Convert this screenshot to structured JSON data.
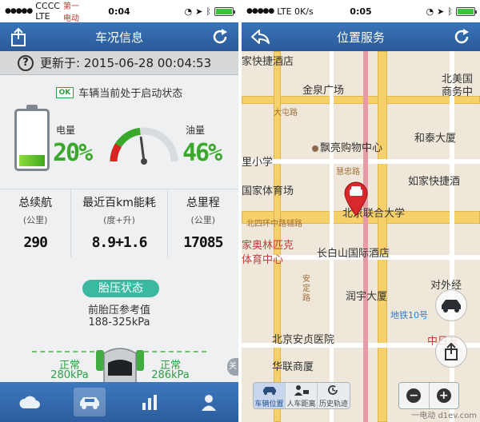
{
  "left": {
    "status": {
      "carrier": "CCCC LTE",
      "time": "0:04",
      "extra": "第一电动"
    },
    "nav": {
      "title": "车况信息"
    },
    "update": {
      "label": "更新于: 2015-06-28 00:04:53"
    },
    "status_line": {
      "badge": "OK",
      "text": "车辆当前处于启动状态"
    },
    "battery": {
      "label": "电量",
      "value": "20%",
      "level": 0.2
    },
    "fuel": {
      "label": "油量",
      "value": "46%",
      "level": 0.46
    },
    "stats": [
      {
        "title": "总续航",
        "unit": "(公里)",
        "value": "290"
      },
      {
        "title": "最近百km能耗",
        "unit": "(度+升)",
        "value": "8.9+1.6"
      },
      {
        "title": "总里程",
        "unit": "(公里)",
        "value": "17085"
      }
    ],
    "tire": {
      "badge": "胎压状态",
      "ref_label": "前胎压参考值",
      "range": "188-325kPa",
      "left_status": "正常",
      "left_value": "280kPa",
      "right_status": "正常",
      "right_value": "286kPa"
    },
    "tabs": [
      {
        "icon": "cloud-icon"
      },
      {
        "icon": "car-icon",
        "active": true
      },
      {
        "icon": "bar-chart-icon"
      },
      {
        "icon": "person-icon"
      }
    ],
    "handle": "关"
  },
  "right": {
    "status": {
      "carrier": "LTE 0K/s",
      "time": "0:05"
    },
    "nav": {
      "title": "位置服务"
    },
    "labels": {
      "l1": "家快捷酒店",
      "l2": "北美国",
      "l3": "商务中",
      "l4": "金泉广场",
      "l5": "大屯路",
      "l6": "和泰大厦",
      "l7": "里小学",
      "l8": "飘亮购物中心",
      "l9": "慧忠路",
      "l10": "如家快捷酒",
      "l11": "国家体育场",
      "l12": "北京联合大学",
      "l13": "北四环中路辅路",
      "l14": "家奥林匹克",
      "l15": "体育中心",
      "l16": "长白山国际酒店",
      "l17": "安定路",
      "l18": "润宇大厦",
      "l19": "对外经",
      "l20": "地铁10号",
      "l21": "北京安贞医院",
      "l22": "中日友",
      "l23": "华联商厦"
    },
    "segments": [
      "车辆位置",
      "人车距离",
      "历史轨迹"
    ],
    "zoom": {
      "out": "−",
      "in": "+"
    },
    "watermark": "一电动 d1ev.com"
  }
}
